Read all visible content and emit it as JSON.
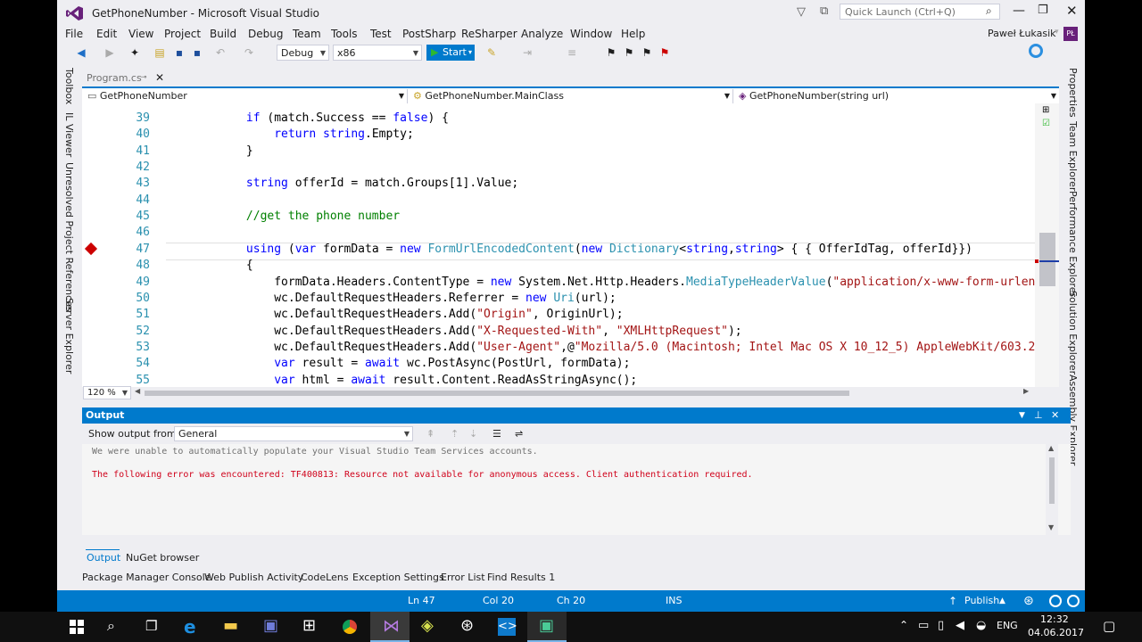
{
  "window": {
    "title": "GetPhoneNumber - Microsoft Visual Studio",
    "quick_launch_placeholder": "Quick Launch (Ctrl+Q)",
    "user": "Paweł Łukasik",
    "user_initials": "PŁ"
  },
  "menu": [
    "File",
    "Edit",
    "View",
    "Project",
    "Build",
    "Debug",
    "Team",
    "Tools",
    "Test",
    "PostSharp",
    "ReSharper",
    "Analyze",
    "Window",
    "Help"
  ],
  "toolbar": {
    "config": "Debug",
    "platform": "x86",
    "start_label": "Start"
  },
  "left_sidebar": [
    "Toolbox",
    "IL Viewer",
    "Unresolved Project References",
    "Server Explorer"
  ],
  "right_sidebar": [
    "Properties",
    "Team Explorer",
    "Performance Explorer",
    "Solution Explorer",
    "Assembly Explorer"
  ],
  "editor": {
    "tab": "Program.cs",
    "nav": {
      "project": "GetPhoneNumber",
      "class": "GetPhoneNumber.MainClass",
      "member": "GetPhoneNumber(string url)"
    },
    "zoom": "120 %",
    "lines": [
      {
        "n": "39",
        "code": "            if (match.Success == false) {"
      },
      {
        "n": "40",
        "code": "                return string.Empty;"
      },
      {
        "n": "41",
        "code": "            }"
      },
      {
        "n": "42",
        "code": ""
      },
      {
        "n": "43",
        "code": "            string offerId = match.Groups[1].Value;"
      },
      {
        "n": "44",
        "code": ""
      },
      {
        "n": "45",
        "code": "            //get the phone number"
      },
      {
        "n": "46",
        "code": ""
      },
      {
        "n": "47",
        "code": "            using (var formData = new FormUrlEncodedContent(new Dictionary<string,string> { { OfferIdTag, offerId}})"
      },
      {
        "n": "48",
        "code": "            {"
      },
      {
        "n": "49",
        "code": "                formData.Headers.ContentType = new System.Net.Http.Headers.MediaTypeHeaderValue(\"application/x-www-form-urlen"
      },
      {
        "n": "50",
        "code": "                wc.DefaultRequestHeaders.Referrer = new Uri(url);"
      },
      {
        "n": "51",
        "code": "                wc.DefaultRequestHeaders.Add(\"Origin\", OriginUrl);"
      },
      {
        "n": "52",
        "code": "                wc.DefaultRequestHeaders.Add(\"X-Requested-With\", \"XMLHttpRequest\");"
      },
      {
        "n": "53",
        "code": "                wc.DefaultRequestHeaders.Add(\"User-Agent\",@\"Mozilla/5.0 (Macintosh; Intel Mac OS X 10_12_5) AppleWebKit/603.2"
      },
      {
        "n": "54",
        "code": "                var result = await wc.PostAsync(PostUrl, formData);"
      },
      {
        "n": "55",
        "code": "                var html = await result.Content.ReadAsStringAsync();"
      }
    ]
  },
  "output": {
    "title": "Output",
    "show_from_label": "Show output from:",
    "source": "General",
    "lines": [
      "We were unable to automatically populate your Visual Studio Team Services accounts.",
      "The following error was encountered: TF400813: Resource not available for anonymous access. Client authentication required."
    ]
  },
  "tool_tabs": [
    "Output",
    "NuGet browser"
  ],
  "bottom_tabs": [
    "Package Manager Console",
    "Web Publish Activity",
    "CodeLens",
    "Exception Settings",
    "Error List",
    "Find Results 1"
  ],
  "status": {
    "ln": "Ln 47",
    "col": "Col 20",
    "ch": "Ch 20",
    "mode": "INS",
    "publish": "Publish"
  },
  "taskbar": {
    "lang": "ENG",
    "time": "12:32",
    "date": "04.06.2017"
  },
  "colors": {
    "accent": "#007ACC",
    "vs_purple": "#68217A",
    "error_text": "#D0021B"
  }
}
